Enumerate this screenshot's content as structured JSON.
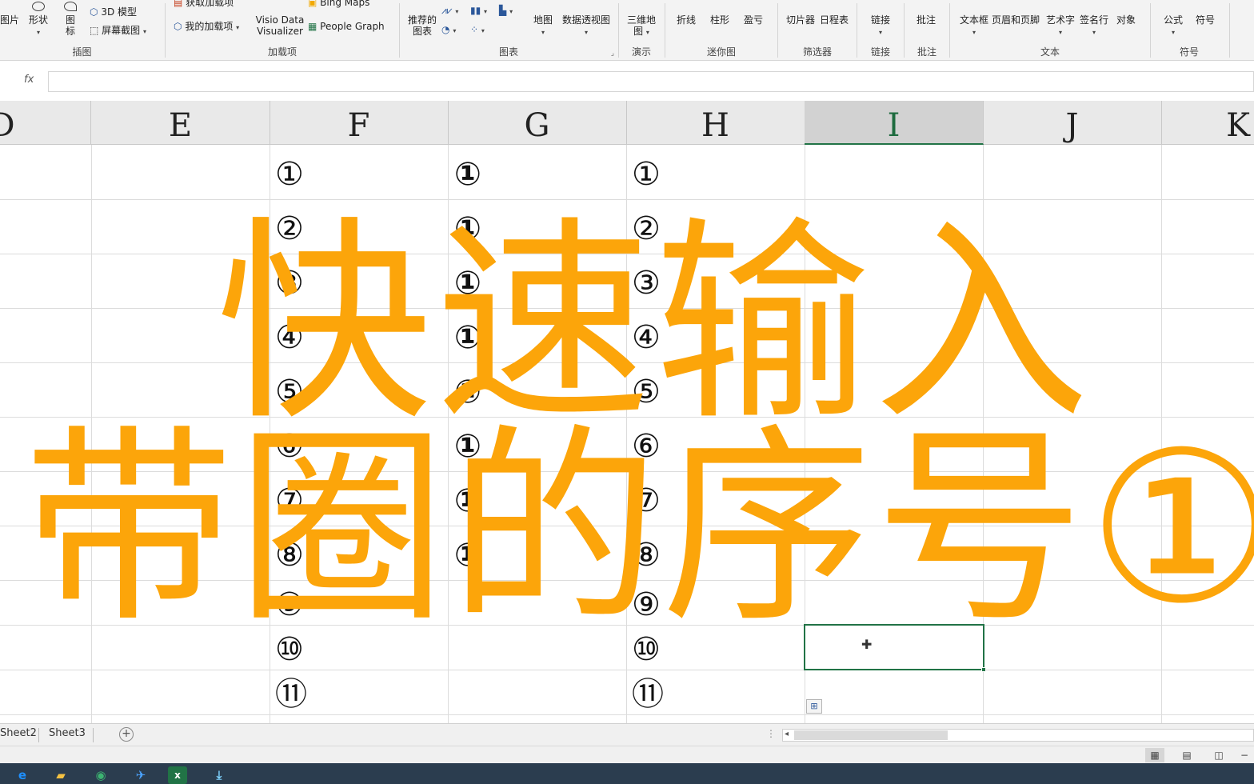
{
  "ribbon": {
    "groups": [
      {
        "label": "插图",
        "buttons": {
          "pictures": "图片",
          "shapes": "形状",
          "icons": "图标",
          "model3d": "3D 模型",
          "screenshot": "屏幕截图"
        }
      },
      {
        "label": "加载项",
        "buttons": {
          "get_addins": "获取加载项",
          "my_addins": "我的加载项",
          "visio": "Visio Data Visualizer",
          "bing_maps": "Bing Maps",
          "people_graph": "People Graph"
        }
      },
      {
        "label": "图表",
        "buttons": {
          "recommended": "推荐的图表",
          "maps": "地图",
          "pivotchart": "数据透视图"
        }
      },
      {
        "label": "演示",
        "buttons": {
          "map3d": "三维地图"
        }
      },
      {
        "label": "迷你图",
        "buttons": {
          "line": "折线",
          "column": "柱形",
          "winloss": "盈亏"
        }
      },
      {
        "label": "筛选器",
        "buttons": {
          "slicer": "切片器",
          "timeline": "日程表"
        }
      },
      {
        "label": "链接",
        "buttons": {
          "link": "链接"
        }
      },
      {
        "label": "批注",
        "buttons": {
          "comment": "批注"
        }
      },
      {
        "label": "文本",
        "buttons": {
          "textbox": "文本框",
          "headerfooter": "页眉和页脚",
          "wordart": "艺术字",
          "signature": "签名行",
          "object": "对象"
        }
      },
      {
        "label": "符号",
        "buttons": {
          "equation": "公式",
          "symbol": "符号"
        }
      }
    ]
  },
  "formula_bar": {
    "fx": "fx",
    "value": ""
  },
  "columns": [
    "D",
    "E",
    "F",
    "G",
    "H",
    "I",
    "J",
    "K"
  ],
  "selected_column": "I",
  "cells": {
    "F": [
      "①",
      "②",
      "③",
      "④",
      "⑤",
      "⑥",
      "⑦",
      "⑧",
      "⑨",
      "⑩",
      "⑪"
    ],
    "G": [
      "①",
      "①",
      "①",
      "①",
      "①",
      "①",
      "①",
      "①"
    ],
    "H": [
      "①",
      "②",
      "③",
      "④",
      "⑤",
      "⑥",
      "⑦",
      "⑧",
      "⑨",
      "⑩",
      "⑪"
    ]
  },
  "overlay": {
    "line1": "快速输入",
    "line2": "带圈的序号①"
  },
  "sheet_tabs": [
    "Sheet2",
    "Sheet3"
  ],
  "colors": {
    "accent": "#217346",
    "overlay_text": "#fca50a"
  }
}
